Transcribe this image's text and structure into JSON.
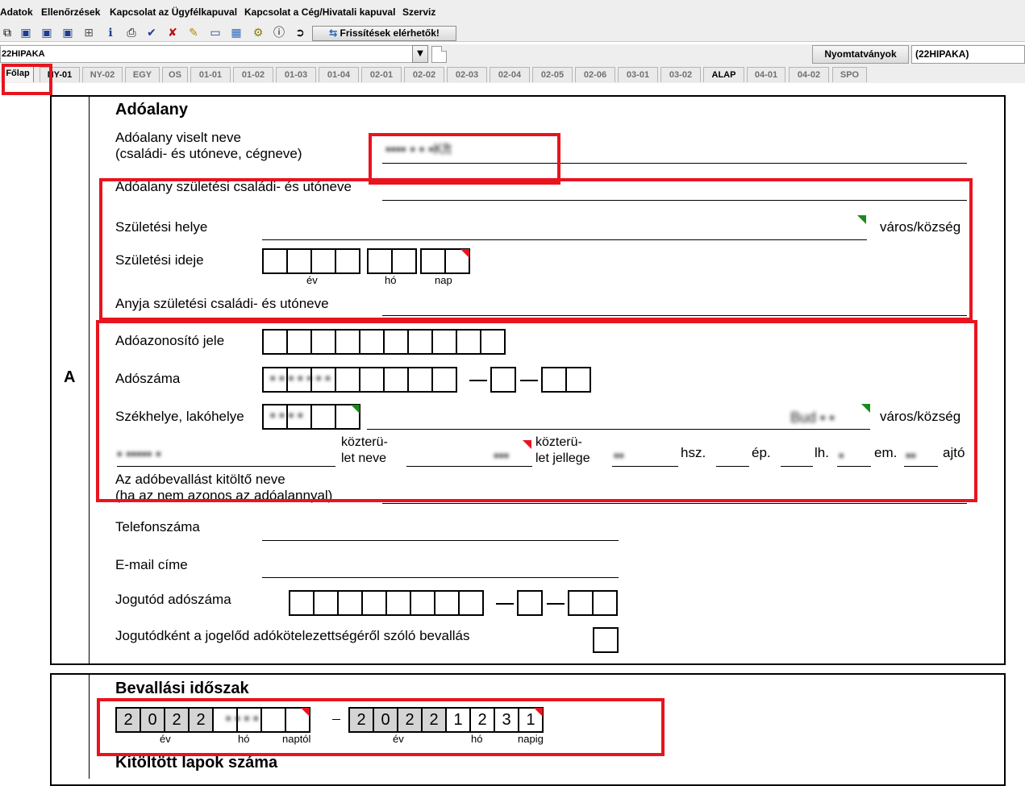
{
  "menu": [
    "Adatok",
    "Ellenőrzések",
    "Kapcsolat az Ügyfélkapuval",
    "Kapcsolat a Cég/Hivatali kapuval",
    "Szerviz"
  ],
  "toolbar": {
    "icons": [
      "copy-icon",
      "save-icon",
      "delete-save-icon",
      "save-as-icon",
      "print-preview-icon",
      "info-icon",
      "print-icon",
      "check-icon",
      "close-x-icon",
      "edit-icon",
      "calculator-icon",
      "forward-icon",
      "tool-icon",
      "about-icon",
      "export-icon"
    ],
    "updates_label": "Frissítések elérhetők!"
  },
  "formbar": {
    "form_name": "22HIPAKA",
    "templates_label": "Nyomtatványok",
    "templates_value": "(22HIPAKA)"
  },
  "tabs": [
    "Főlap",
    "NY-01",
    "NY-02",
    "EGY",
    "OS",
    "01-01",
    "01-02",
    "01-03",
    "01-04",
    "02-01",
    "02-02",
    "02-03",
    "02-04",
    "02-05",
    "02-06",
    "03-01",
    "03-02",
    "ALAP",
    "04-01",
    "04-02",
    "SPO"
  ],
  "section_a": {
    "letter": "A",
    "title": "Adóalany",
    "name_label_1": "Adóalany viselt neve",
    "name_label_2": "(családi- és utóneve, cégneve)",
    "name_value": "Kft",
    "birth_name_label": "Adóalany születési családi- és utóneve",
    "birth_place_label": "Születési helye",
    "city_label": "város/község",
    "birth_date_label": "Születési ideje",
    "year_label": "év",
    "month_label": "hó",
    "day_label": "nap",
    "mother_label": "Anyja születési családi- és utóneve",
    "tax_id_label": "Adóazonosító jele",
    "tax_number_label": "Adószáma",
    "seat_label": "Székhelye, lakóhelye",
    "seat_city_value": "Bud",
    "street_name_label_1": "közterü-",
    "street_name_label_2": "let neve",
    "street_type_label_1": "közterü-",
    "street_type_label_2": "let jellege",
    "hsz_label": "hsz.",
    "ep_label": "ép.",
    "lh_label": "lh.",
    "em_label": "em.",
    "ajto_label": "ajtó",
    "filler_label_1": "Az adóbevallást kitöltő neve",
    "filler_label_2": "(ha az nem azonos az adóalannyal)",
    "phone_label": "Telefonszáma",
    "email_label": "E-mail címe",
    "successor_label": "Jogutód adószáma",
    "successor_decl_label": "Jogutódként a jogelőd adókötelezettségéről szóló bevallás"
  },
  "section_b": {
    "period_title": "Bevallási időszak",
    "from_digits": [
      "2",
      "0",
      "2",
      "2",
      "",
      "",
      "",
      ""
    ],
    "to_digits": [
      "2",
      "0",
      "2",
      "2",
      "1",
      "2",
      "3",
      "1"
    ],
    "year_label": "év",
    "month_label": "hó",
    "from_label": "naptól",
    "to_label": "napig",
    "pages_title": "Kitöltött lapok száma"
  },
  "colors": {
    "highlight": "#e8141e",
    "flag_green": "#1a8a1a",
    "flag_red": "#e8141e",
    "readonly_cell": "#d4d4d4"
  }
}
